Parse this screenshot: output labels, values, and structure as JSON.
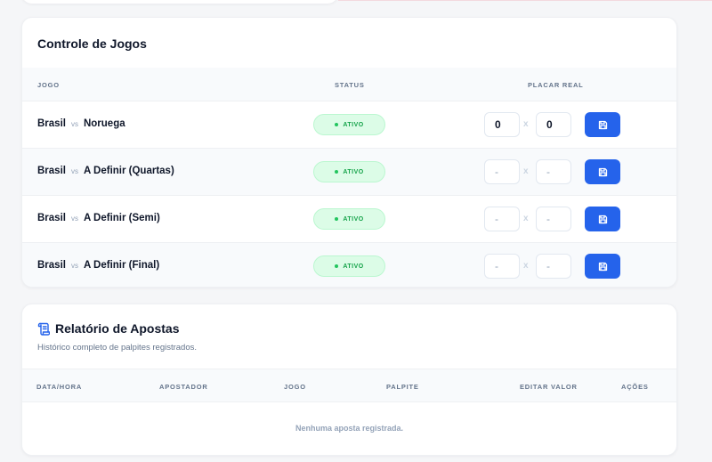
{
  "games_panel": {
    "title": "Controle de Jogos",
    "columns": {
      "game": "JOGO",
      "status": "STATUS",
      "score": "PLACAR REAL"
    },
    "vs_label": "vs",
    "score_separator": "x",
    "games": [
      {
        "home": "Brasil",
        "away": "Noruega",
        "status": "ATIVO",
        "home_score": "0",
        "away_score": "0",
        "home_placeholder": "-",
        "away_placeholder": "-"
      },
      {
        "home": "Brasil",
        "away": "A Definir (Quartas)",
        "status": "ATIVO",
        "home_score": "",
        "away_score": "",
        "home_placeholder": "-",
        "away_placeholder": "-"
      },
      {
        "home": "Brasil",
        "away": "A Definir (Semi)",
        "status": "ATIVO",
        "home_score": "",
        "away_score": "",
        "home_placeholder": "-",
        "away_placeholder": "-"
      },
      {
        "home": "Brasil",
        "away": "A Definir (Final)",
        "status": "ATIVO",
        "home_score": "",
        "away_score": "",
        "home_placeholder": "-",
        "away_placeholder": "-"
      }
    ]
  },
  "bets_panel": {
    "title": "Relatório de Apostas",
    "subtitle": "Histórico completo de palpites registrados.",
    "icon": "scroll-icon",
    "columns": {
      "datetime": "DATA/HORA",
      "bettor": "APOSTADOR",
      "game": "JOGO",
      "guess": "PALPITE",
      "edit_value": "EDITAR VALOR",
      "actions": "AÇÕES"
    },
    "empty_message": "Nenhuma aposta registrada."
  },
  "colors": {
    "accent": "#2563eb",
    "status_active_bg": "#dcfce7",
    "status_active_text": "#16a34a",
    "muted_text": "#94a3b8"
  }
}
